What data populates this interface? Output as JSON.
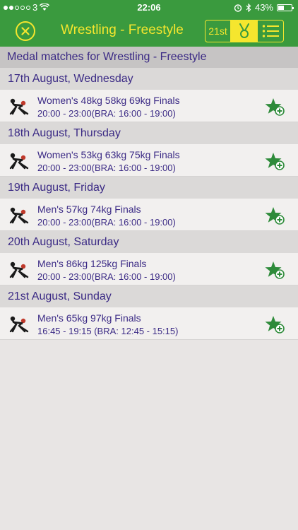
{
  "status_bar": {
    "carrier": "3",
    "time": "22:06",
    "battery": "43%",
    "battery_level": 0.43,
    "icons": [
      "signal-dots",
      "wifi-icon",
      "alarm-icon",
      "bluetooth-icon",
      "battery-icon"
    ]
  },
  "nav": {
    "title": "Wrestling - Freestyle",
    "day_label": "21st",
    "close_icon": "close-icon",
    "medal_icon": "medal-icon",
    "list_icon": "list-icon",
    "colors": {
      "bar": "#3a9a3e",
      "accent": "#f5e62e"
    }
  },
  "section_title": "Medal matches for Wrestling - Freestyle",
  "days": [
    {
      "date": "17th August, Wednesday",
      "event": "Women's 48kg 58kg 69kg Finals",
      "time": "20:00 - 23:00(BRA: 16:00 - 19:00)"
    },
    {
      "date": "18th August, Thursday",
      "event": "Women's 53kg 63kg 75kg Finals",
      "time": "20:00 - 23:00(BRA: 16:00 - 19:00)"
    },
    {
      "date": "19th August, Friday",
      "event": "Men's 57kg 74kg Finals",
      "time": "20:00 - 23:00(BRA: 16:00 - 19:00)"
    },
    {
      "date": "20th August, Saturday",
      "event": "Men's 86kg 125kg Finals",
      "time": "20:00 - 23:00(BRA: 16:00 - 19:00)"
    },
    {
      "date": "21st August, Sunday",
      "event": "Men's 65kg 97kg Finals",
      "time": "16:45 - 19:15  (BRA: 12:45 - 15:15)"
    }
  ],
  "event_icon": "wrestling-icon",
  "favorite_icon": "add-favorite-star-icon",
  "text_color": "#3b2a85",
  "star_color": "#2e8b3a"
}
